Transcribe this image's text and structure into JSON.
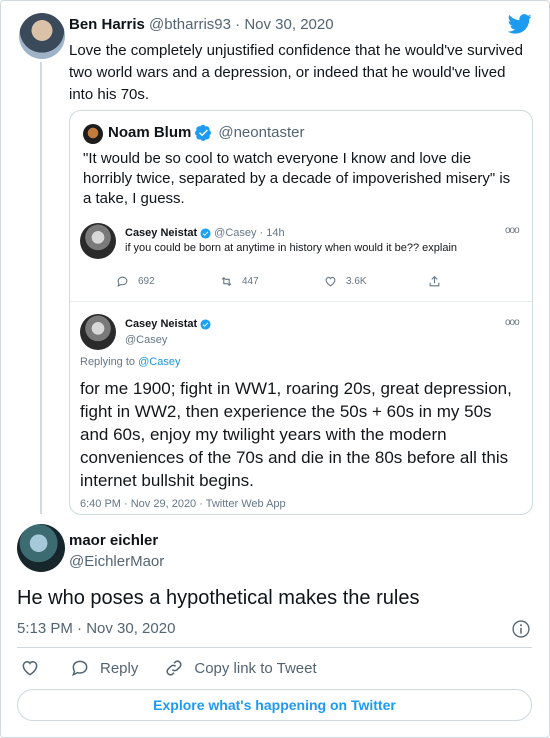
{
  "parent": {
    "name": "Ben Harris",
    "handle": "@btharris93",
    "separator": "·",
    "date": "Nov 30, 2020",
    "text": "Love the completely unjustified confidence that he would've survived\ntwo world wars and a depression, or indeed that he   would've lived\ninto his 70s."
  },
  "quote": {
    "name": "Noam Blum",
    "handle": "@neontaster",
    "text": "\"It would be so cool to watch everyone I know and love die horribly twice, separated by a decade of impoverished misery\" is a take, I guess."
  },
  "screenshot": {
    "first": {
      "name": "Casey Neistat",
      "meta": "@Casey · 14h",
      "text": "if you could be born at anytime in history when would it be??  explain",
      "more": "ooo",
      "replies": "692",
      "retweets": "447",
      "likes": "3.6K"
    },
    "second": {
      "name": "Casey Neistat",
      "handle": "@Casey",
      "more": "ooo",
      "replying_prefix": "Replying to",
      "replying_to": "@Casey",
      "text": "for me 1900; fight in WW1, roaring 20s, great depression, fight in WW2, then experience the 50s + 60s in my 50s and 60s, enjoy my twilight years with the modern conveniences of the 70s and die in the 80s before all this internet bullshit begins.",
      "footer": "6:40 PM · Nov 29, 2020 · Twitter Web App"
    }
  },
  "reply": {
    "name": "maor eichler",
    "handle": "@EichlerMaor",
    "text": "He who poses a hypothetical makes the rules",
    "time": "5:13 PM · Nov 30, 2020"
  },
  "actions": {
    "reply_label": "Reply",
    "copy_label": "Copy link to Tweet"
  },
  "explore_label": "Explore what's happening on Twitter",
  "colors": {
    "brand": "#1d9bf0",
    "text": "#0f1419",
    "muted": "#536471",
    "border": "#cfd9de"
  }
}
